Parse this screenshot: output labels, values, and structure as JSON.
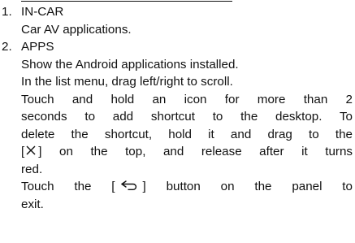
{
  "items": [
    {
      "number": "1.",
      "title": "IN-CAR",
      "lines": [
        "Car AV applications."
      ]
    },
    {
      "number": "2.",
      "title": "APPS",
      "lines": [
        "Show the Android applications installed.",
        "In the list menu, drag left/right to scroll.",
        "Touch and hold an icon for more than 2",
        "seconds to add shortcut to the desktop. To",
        "delete the shortcut, hold it and drag to the",
        "on the top, and release after it turns",
        "red.",
        "Touch the [",
        "] button on the panel to",
        "exit."
      ]
    }
  ],
  "icons": {
    "delete": "close-x-icon",
    "back": "back-arrow-icon"
  }
}
